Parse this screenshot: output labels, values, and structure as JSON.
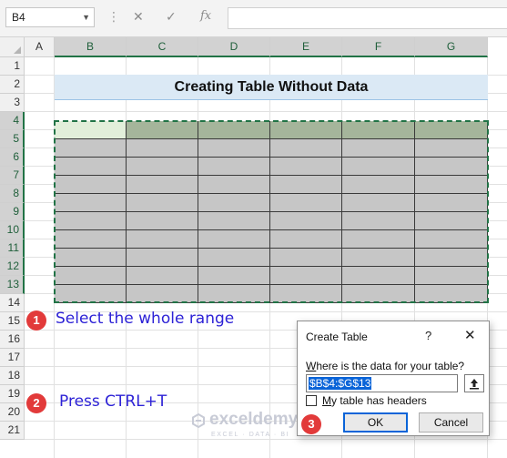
{
  "formula_bar": {
    "name_box": "B4",
    "dots": "⋮",
    "cancel_glyph": "✕",
    "enter_glyph": "✓",
    "fx_label": "fx",
    "formula": ""
  },
  "columns": [
    "A",
    "B",
    "C",
    "D",
    "E",
    "F",
    "G"
  ],
  "rows": [
    "1",
    "2",
    "3",
    "4",
    "5",
    "6",
    "7",
    "8",
    "9",
    "10",
    "11",
    "12",
    "13",
    "14",
    "15",
    "16",
    "17",
    "18",
    "19",
    "20",
    "21"
  ],
  "sheet": {
    "title": "Creating Table Without Data"
  },
  "annotations": [
    {
      "num": "1",
      "text": "Select the whole range"
    },
    {
      "num": "2",
      "text": "Press CTRL+T"
    },
    {
      "num": "3",
      "text": ""
    }
  ],
  "watermark": {
    "name": "exceldemy",
    "sub": "EXCEL · DATA · BI"
  },
  "dialog": {
    "title": "Create Table",
    "help": "?",
    "close": "✕",
    "prompt_key": "W",
    "prompt_rest": "here is the data for your table?",
    "range_value": "$B$4:$G$13",
    "checkbox_key": "M",
    "checkbox_rest": "y table has headers",
    "checkbox_checked": false,
    "ok_label": "OK",
    "cancel_label": "Cancel"
  },
  "colors": {
    "accent": "#217346",
    "annotation_text": "#2d22d6",
    "badge": "#e23a3a",
    "title_fill": "#dbe9f5",
    "range_fill": "#c6c6c6",
    "header_fill": "#a5b59b"
  }
}
